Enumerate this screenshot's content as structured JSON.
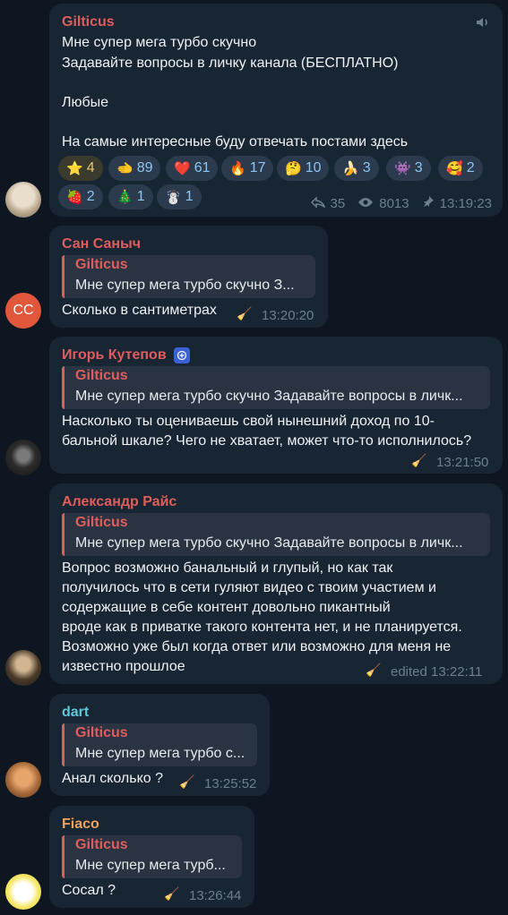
{
  "colors": {
    "background": "#0e1621",
    "bubble": "#182533",
    "reply_accent": "#e05d5d",
    "meta": "#6d7f8f"
  },
  "post": {
    "sender": "Gilticus",
    "lines": [
      "Мне супер мега турбо скучно",
      "Задавайте вопросы в личку канала (БЕСПЛАТНО)",
      "Любые",
      "На самые интересные буду отвечать постами здесь"
    ],
    "reactions": [
      {
        "emoji": "⭐",
        "count": "4"
      },
      {
        "emoji": "🫲",
        "count": "89"
      },
      {
        "emoji": "❤️",
        "count": "61"
      },
      {
        "emoji": "🔥",
        "count": "17"
      },
      {
        "emoji": "🤔",
        "count": "10"
      },
      {
        "emoji": "🍌",
        "count": "3"
      },
      {
        "emoji": "👾",
        "count": "3"
      },
      {
        "emoji": "🥰",
        "count": "2"
      },
      {
        "emoji": "🍓",
        "count": "2"
      },
      {
        "emoji": "🎄",
        "count": "1"
      },
      {
        "emoji": "☃️",
        "count": "1"
      }
    ],
    "forwards": "35",
    "views": "8013",
    "time": "13:19:23"
  },
  "comments": [
    {
      "sender": "Сан Саныч",
      "reply_name": "Gilticus",
      "reply_text": "Мне супер мега турбо скучно З...",
      "lines": [
        "Сколько в сантиметрах"
      ],
      "time": "13:20:20",
      "avatar_initials": "CC"
    },
    {
      "sender": "Игорь Кутепов",
      "reply_name": "Gilticus",
      "reply_text": "Мне супер мега турбо скучно Задавайте вопросы в личк...",
      "lines": [
        "Насколько ты оцениваешь свой нынешний доход по 10-",
        "бальной шкале? Чего не хватает, может что-то исполнилось?"
      ],
      "time": "13:21:50"
    },
    {
      "sender": "Александр Райс",
      "reply_name": "Gilticus",
      "reply_text": "Мне супер мега турбо скучно Задавайте вопросы в личк...",
      "lines": [
        "Вопрос возможно банальный и глупый, но как так",
        "получилось что в сети гуляют видео с твоим участием и",
        "содержащие в себе контент довольно пикантный",
        "вроде как в приватке такого контента нет, и не планируется.",
        "Возможно уже был когда ответ или возможно для меня не",
        "известно прошлое"
      ],
      "time": "edited 13:22:11"
    },
    {
      "sender": "dart",
      "reply_name": "Gilticus",
      "reply_text": "Мне супер мега турбо с...",
      "lines": [
        "Анал сколько ?"
      ],
      "time": "13:25:52"
    },
    {
      "sender": "Fiaco",
      "reply_name": "Gilticus",
      "reply_text": "Мне супер мега турб...",
      "lines": [
        "Сосал ?"
      ],
      "time": "13:26:44"
    }
  ]
}
